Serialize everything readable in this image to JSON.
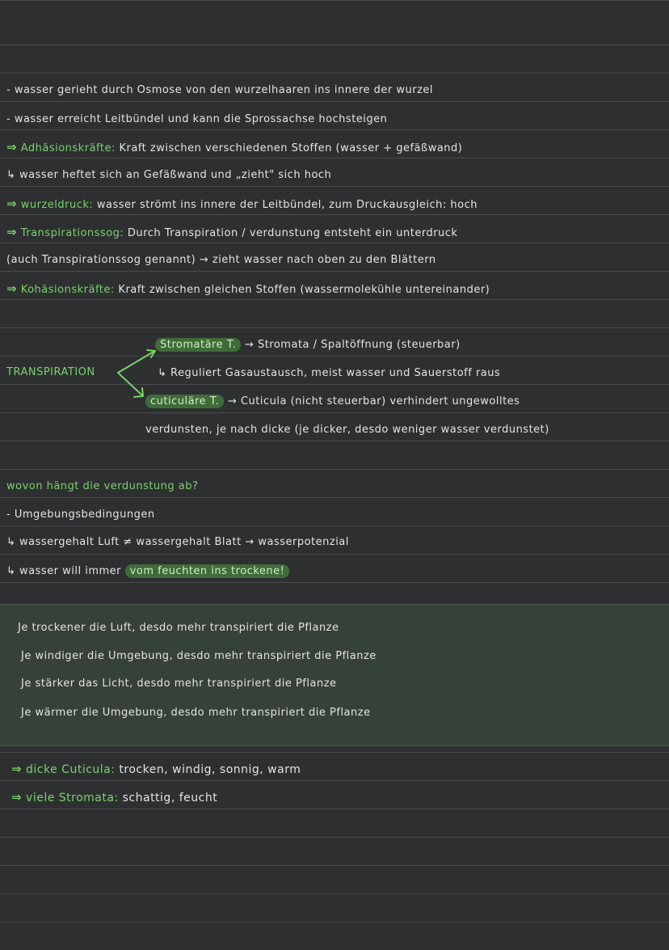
{
  "colors": {
    "background": "#2e2f31",
    "accent": "#78d36a",
    "highlight": "#3f6b3a",
    "box": "#364138"
  },
  "notes": {
    "l1": "- wasser gerieht durch Osmose von den wurzelhaaren ins innere der wurzel",
    "l2": "- wasser erreicht Leitbündel und kann die Sprossachse hochsteigen",
    "l3_arrow": "⇒",
    "l3_term": "Adhäsionskräfte:",
    "l3_text": "Kraft zwischen verschiedenen Stoffen (wasser + gefäßwand)",
    "l4": "↳ wasser heftet sich an Gefäßwand und „zieht\" sich hoch",
    "l5_arrow": "⇒",
    "l5_term": "wurzeldruck:",
    "l5_text": "wasser strömt ins innere der Leitbündel, zum Druckausgleich: hoch",
    "l6_arrow": "⇒",
    "l6_term": "Transpirationssog:",
    "l6_text": "Durch Transpiration / verdunstung entsteht ein unterdruck",
    "l7": "(auch Transpirationssog genannt) → zieht wasser nach oben zu den Blättern",
    "l8_arrow": "⇒",
    "l8_term": "Kohäsionskräfte:",
    "l8_text": "Kraft zwischen gleichen Stoffen (wassermolekühle untereinander)"
  },
  "transpiration": {
    "label": "TRANSPIRATION",
    "stom_term": "Stromatäre T.",
    "stom_text": "→ Stromata / Spaltöffnung (steuerbar)",
    "stom_sub": "↳ Reguliert Gasaustausch, meist wasser und Sauerstoff raus",
    "cut_term": "cuticuläre T.",
    "cut_text": "→ Cuticula (nicht steuerbar) verhindert ungewolltes",
    "cut_text2": "verdunsten, je nach dicke (je dicker, desdo weniger wasser verdunstet)"
  },
  "question": {
    "title": "wovon hängt die verdunstung ab?",
    "q1": "- Umgebungsbedingungen",
    "q2": "↳ wassergehalt Luft ≠ wassergehalt Blatt → wasserpotenzial",
    "q3_pre": "↳ wasser will immer",
    "q3_pill": "vom feuchten ins trockene!"
  },
  "box": {
    "b1": "Je trockener die Luft, desdo mehr transpiriert die Pflanze",
    "b2": "Je windiger die Umgebung, desdo mehr transpiriert die Pflanze",
    "b3": "Je stärker das Licht, desdo mehr transpiriert die Pflanze",
    "b4": "Je wärmer die Umgebung, desdo mehr transpiriert die Pflanze"
  },
  "summary": {
    "s1_arrow": "⇒",
    "s1_term": "dicke Cuticula:",
    "s1_text": "trocken, windig, sonnig, warm",
    "s2_arrow": "⇒",
    "s2_term": "viele Stromata:",
    "s2_text": "schattig, feucht"
  }
}
